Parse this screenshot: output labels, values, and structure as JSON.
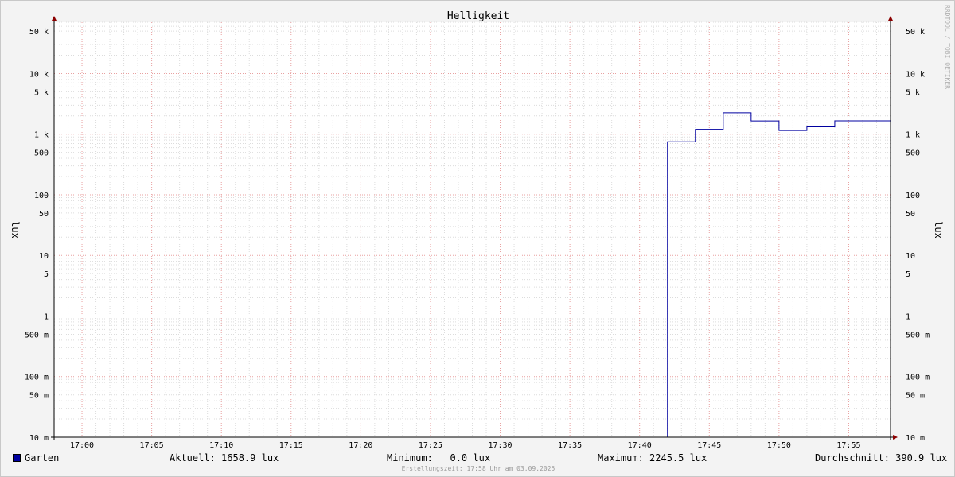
{
  "chart_data": {
    "type": "line",
    "title": "Helligkeit",
    "ylabel": "lux",
    "ylabel_right": "lux",
    "yscale": "log",
    "ylim": [
      0.01,
      70000
    ],
    "xlim": [
      "16:58",
      "17:58"
    ],
    "x_ticks": [
      "17:00",
      "17:05",
      "17:10",
      "17:15",
      "17:20",
      "17:25",
      "17:30",
      "17:35",
      "17:40",
      "17:45",
      "17:50",
      "17:55"
    ],
    "y_ticks": [
      {
        "value": 0.01,
        "label": "10 m"
      },
      {
        "value": 0.05,
        "label": "50 m"
      },
      {
        "value": 0.1,
        "label": "100 m"
      },
      {
        "value": 0.5,
        "label": "500 m"
      },
      {
        "value": 1,
        "label": "1"
      },
      {
        "value": 5,
        "label": "5"
      },
      {
        "value": 10,
        "label": "10"
      },
      {
        "value": 50,
        "label": "50"
      },
      {
        "value": 100,
        "label": "100"
      },
      {
        "value": 500,
        "label": "500"
      },
      {
        "value": 1000,
        "label": "1 k"
      },
      {
        "value": 5000,
        "label": "5 k"
      },
      {
        "value": 10000,
        "label": "10 k"
      },
      {
        "value": 50000,
        "label": "50 k"
      }
    ],
    "grid": true,
    "legend_position": "bottom",
    "series": [
      {
        "name": "Garten",
        "color": "#0000a0",
        "step": true,
        "x": [
          "16:58",
          "17:42",
          "17:44",
          "17:46",
          "17:48",
          "17:50",
          "17:52",
          "17:54",
          "17:58"
        ],
        "y": [
          0.0,
          750,
          1200,
          2245.5,
          1650,
          1150,
          1320,
          1658.9,
          1658.9
        ]
      }
    ]
  },
  "legend": {
    "series_name": "Garten",
    "current": "Aktuell: 1658.9 lux",
    "minimum": "Minimum:   0.0 lux",
    "maximum": "Maximum: 2245.5 lux",
    "average": "Durchschnitt: 390.9 lux"
  },
  "footer": "Erstellungszeit: 17:58 Uhr am 03.09.2025",
  "watermark": "RRDTOOL / TOBI OETIKER"
}
